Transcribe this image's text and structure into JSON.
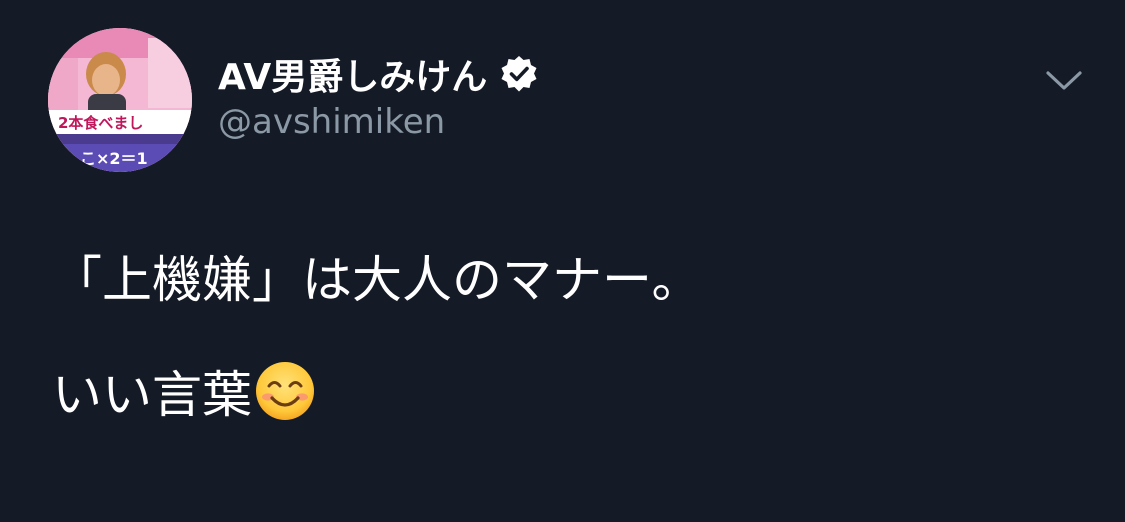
{
  "tweet": {
    "author": {
      "display_name": "AV男爵しみけん",
      "handle": "@avshimiken",
      "verified": true,
      "avatar_caption_1": "2本食べまし",
      "avatar_caption_2": "こ×2＝1"
    },
    "lines": [
      "「上機嫌」は大人のマナー。",
      "いい言葉"
    ],
    "emoji": "smiling-face-with-smiling-eyes-emoji"
  },
  "colors": {
    "background": "#151b26",
    "text": "#ffffff",
    "secondary_text": "#8b98a5"
  },
  "icons": {
    "verified": "verified-badge-icon",
    "menu": "chevron-down-icon"
  }
}
